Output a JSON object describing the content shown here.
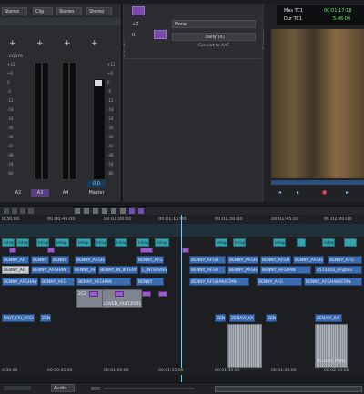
{
  "mixer": {
    "top_dropdowns": [
      "Stereo",
      "Clip",
      "Stereo",
      "Stereo"
    ],
    "eq_label": "EQ376",
    "scale_left": [
      "+12",
      "+6",
      "0",
      "-6",
      "-12",
      "-18",
      "-24",
      "-30",
      "-36",
      "-42",
      "-48",
      "-54",
      "-60"
    ],
    "scale_master": [
      "+12",
      "+6",
      "0",
      "-6",
      "-12",
      "-18",
      "-24",
      "-30",
      "-36",
      "-42",
      "-48",
      "-54",
      "-60"
    ],
    "channel_labels": [
      "A2",
      "A3",
      "A4",
      "Master"
    ],
    "master_value": "0.0",
    "side_tab": "Audio Mixer"
  },
  "automation": {
    "side_tab": "Audio Mix",
    "value1": "+2",
    "value2": "0",
    "dropdown1": "None",
    "dropdown2": "Daily (X)",
    "convert_label": "Convert to AAF"
  },
  "viewer": {
    "side_tab": "Composer",
    "tc1_label": "Mas TC1",
    "tc1_value": "00:01:17:18",
    "tc2_label": "Dur TC1",
    "tc2_value": "5:46:06"
  },
  "timeline": {
    "ruler": [
      "0:30:00",
      "00:00:45:00",
      "00:01:00:00",
      "00:01:15:00",
      "00:01:30:00",
      "00:01:45:00",
      "00:02:00:00"
    ],
    "bottom_ruler": [
      "0:30:00",
      "00:00:45:00",
      "00:01:00:00",
      "00:01:15:00",
      "00:01:30:00",
      "00:01:45:00",
      "00:02:00:00"
    ],
    "clips_video": [
      "Intap",
      "Intap",
      "Intap",
      "Intap",
      "Intap",
      "Intap",
      "Intap",
      "Intap",
      "Intap",
      "Intap",
      "Intap",
      "Intap",
      "Intap"
    ],
    "clips_row1": [
      "BENNY_AF",
      "BENNY",
      "BENNY",
      "BENNY_AFGHA",
      "BENNY_AFGH",
      "BENNY_AFGH",
      "BENNY_AFGHA",
      "BENNY_AFGH",
      "BENNY_AFGHAN",
      "BENNY_AFG"
    ],
    "clips_row2": [
      "BENNY_AF",
      "BENNY_AFGHAN",
      "BENNY_AFG",
      "BENNY_IN_INTERVIEW",
      "L_INTERVIEW",
      "BENNY_AFGH",
      "BENNY_AFGHAN",
      "BENNY_AFGHAN",
      "4572003_AFghan"
    ],
    "clips_row3": [
      "BENNY_AFGHANISTAN",
      "BENNY_AFG",
      "BENNY_AFGHAN",
      "BENNY",
      "BENNY_AFGHANISTAN",
      "BENNY_AFG",
      "BENNY_AFGHANISTAN"
    ],
    "clips_row4": [
      "2C2",
      "LOVED_OUTCRY01"
    ],
    "clips_row5": [
      "UNIT_FRI_AFGHAN",
      "ZENA",
      "ZENA",
      "ZENAVI_KA",
      "ZENAVI_K",
      "ZENAVI_KA"
    ],
    "clip_tail": "4572003_Afgha",
    "status_dropdown": "Audio"
  },
  "colors": {
    "video_clip": "#3aa0ad",
    "audio_clip": "#3b6db3",
    "effect": "#9a5cc8",
    "playhead": "#6ad0ff"
  }
}
